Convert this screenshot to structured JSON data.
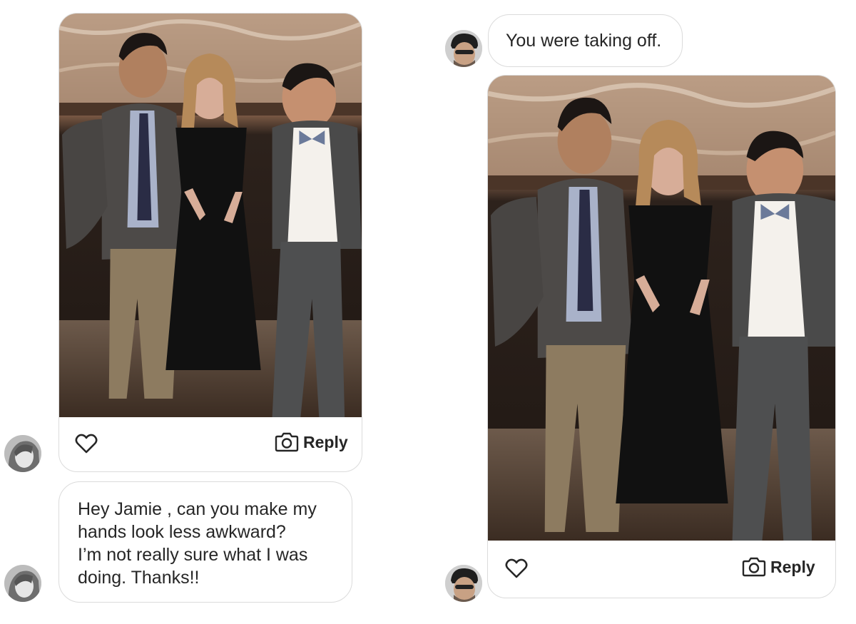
{
  "left_thread": {
    "photo_alt": "",
    "reply_label": "Reply",
    "message_text": "Hey Jamie , can you make my\nhands look less awkward?\nI’m not really sure what I was\ndoing. Thanks!!"
  },
  "right_thread": {
    "message_text": "You were taking off.",
    "reply_label": "Reply"
  },
  "icons": {
    "heart": "heart-icon",
    "camera": "camera-icon"
  },
  "colors": {
    "border": "#dbdbdb",
    "text": "#262626",
    "dress": "#111111",
    "jacket": "#4a4a4a",
    "background_wall": "#3a2a22"
  }
}
